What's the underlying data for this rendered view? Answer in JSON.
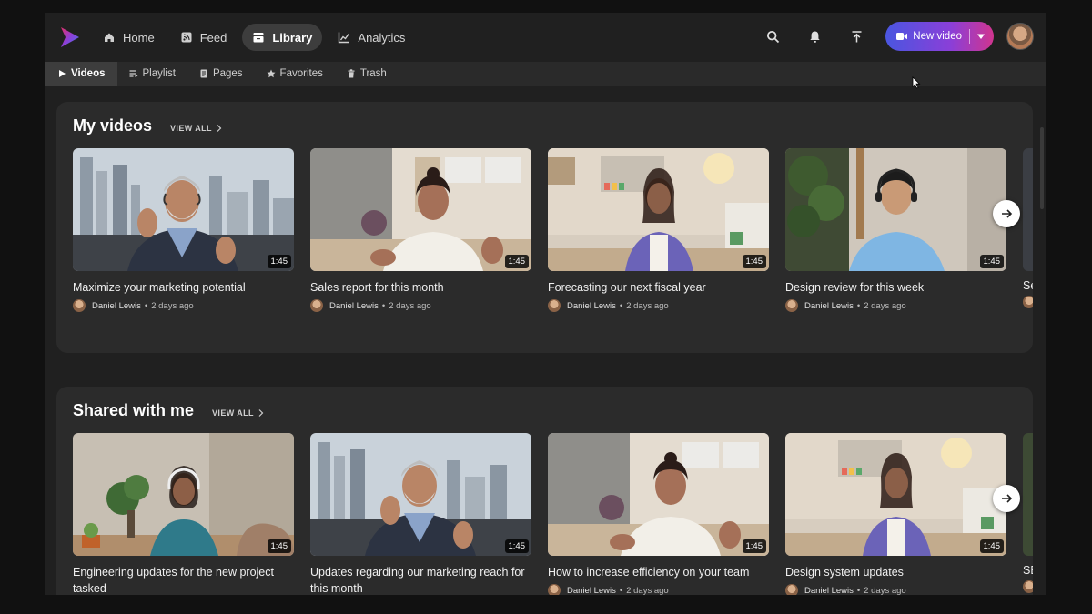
{
  "nav": {
    "items": [
      {
        "label": "Home",
        "icon": "home-icon"
      },
      {
        "label": "Feed",
        "icon": "feed-icon"
      },
      {
        "label": "Library",
        "icon": "library-icon",
        "active": true
      },
      {
        "label": "Analytics",
        "icon": "analytics-icon"
      }
    ],
    "new_video_label": "New video"
  },
  "subtabs": [
    {
      "label": "Videos",
      "icon": "play-icon",
      "active": true
    },
    {
      "label": "Playlist",
      "icon": "playlist-icon"
    },
    {
      "label": "Pages",
      "icon": "pages-icon"
    },
    {
      "label": "Favorites",
      "icon": "star-icon"
    },
    {
      "label": "Trash",
      "icon": "trash-icon"
    }
  ],
  "sections": [
    {
      "title": "My videos",
      "view_all": "VIEW ALL",
      "cards": [
        {
          "title": "Maximize your marketing potential",
          "author": "Daniel Lewis",
          "age": "2 days ago",
          "duration": "1:45"
        },
        {
          "title": "Sales report for this month",
          "author": "Daniel Lewis",
          "age": "2 days ago",
          "duration": "1:45"
        },
        {
          "title": "Forecasting our next fiscal year",
          "author": "Daniel Lewis",
          "age": "2 days ago",
          "duration": "1:45"
        },
        {
          "title": "Design review for this week",
          "author": "Daniel Lewis",
          "age": "2 days ago",
          "duration": "1:45"
        }
      ],
      "partial_title": "Se"
    },
    {
      "title": "Shared with me",
      "view_all": "VIEW ALL",
      "cards": [
        {
          "title": "Engineering updates for the new project tasked",
          "author": "",
          "age": "",
          "duration": "1:45"
        },
        {
          "title": "Updates regarding our marketing reach for this month",
          "author": "",
          "age": "",
          "duration": "1:45"
        },
        {
          "title": "How to increase efficiency on your team",
          "author": "Daniel Lewis",
          "age": "2 days ago",
          "duration": "1:45"
        },
        {
          "title": "Design system updates",
          "author": "Daniel Lewis",
          "age": "2 days ago",
          "duration": "1:45"
        }
      ],
      "partial_title": "SE"
    }
  ],
  "meta_separator": "•",
  "colors": {
    "accent_gradient_start": "#4a56e0",
    "accent_gradient_end": "#d0358f",
    "background": "#202020",
    "panel": "#2b2b2b"
  }
}
